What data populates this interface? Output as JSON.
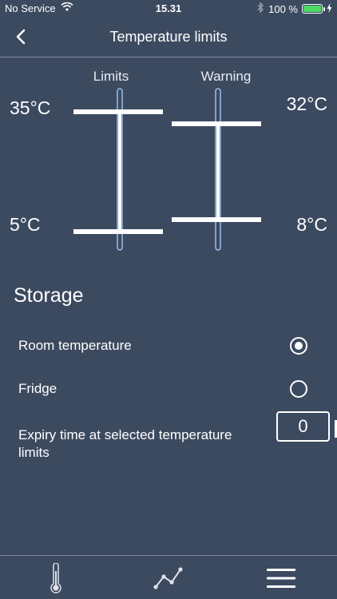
{
  "status_bar": {
    "carrier": "No Service",
    "time": "15.31",
    "battery": "100 %",
    "icons": [
      "wifi-icon",
      "bluetooth-icon",
      "battery-icon",
      "charging-icon"
    ]
  },
  "nav": {
    "back_icon": "chevron-left-icon",
    "title": "Temperature limits"
  },
  "gauges": {
    "limits": {
      "label": "Limits",
      "high": "35°C",
      "low": "5°C",
      "high_value": 35,
      "low_value": 5
    },
    "warning": {
      "label": "Warning",
      "high": "32°C",
      "low": "8°C",
      "high_value": 32,
      "low_value": 8
    }
  },
  "storage": {
    "title": "Storage",
    "options": [
      {
        "label": "Room temperature",
        "selected": true
      },
      {
        "label": "Fridge",
        "selected": false
      }
    ],
    "expiry_label": "Expiry time at selected temperature limits",
    "expiry_value": "0"
  },
  "tabs": [
    {
      "icon": "thermometer-icon"
    },
    {
      "icon": "chart-line-icon"
    },
    {
      "icon": "menu-icon"
    }
  ],
  "colors": {
    "background": "#3c4a60",
    "accent": "#ffffff",
    "gauge_track": "#a8d0ff",
    "battery": "#4cd964"
  }
}
